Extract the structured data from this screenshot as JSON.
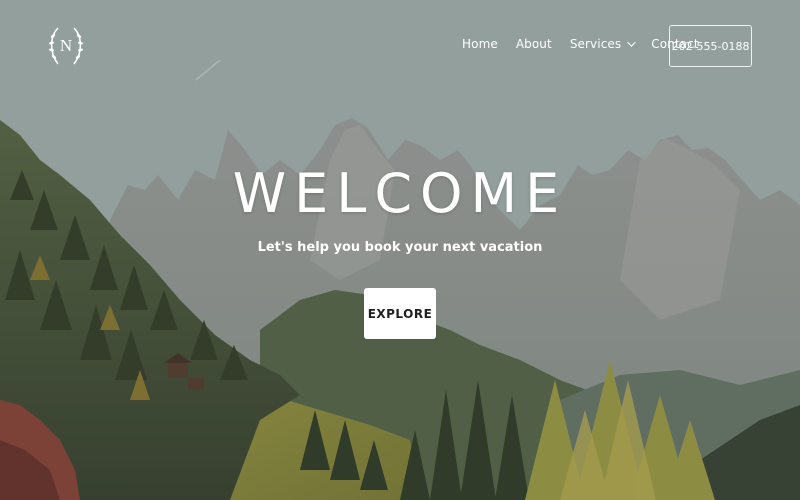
{
  "header": {
    "logo_letter": "N",
    "nav": [
      {
        "label": "Home"
      },
      {
        "label": "About"
      },
      {
        "label": "Services"
      },
      {
        "label": "Contact"
      }
    ],
    "phone": "202-555-0188"
  },
  "hero": {
    "title": "WELCOME",
    "subtitle": "Let's help you book your next vacation",
    "cta_label": "EXPLORE"
  },
  "icons": {
    "logo": "laurel-wreath-icon",
    "services_dropdown": "chevron-down-icon"
  },
  "colors": {
    "text": "#ffffff",
    "button_bg": "#ffffff",
    "button_text": "#1f1f1f"
  }
}
